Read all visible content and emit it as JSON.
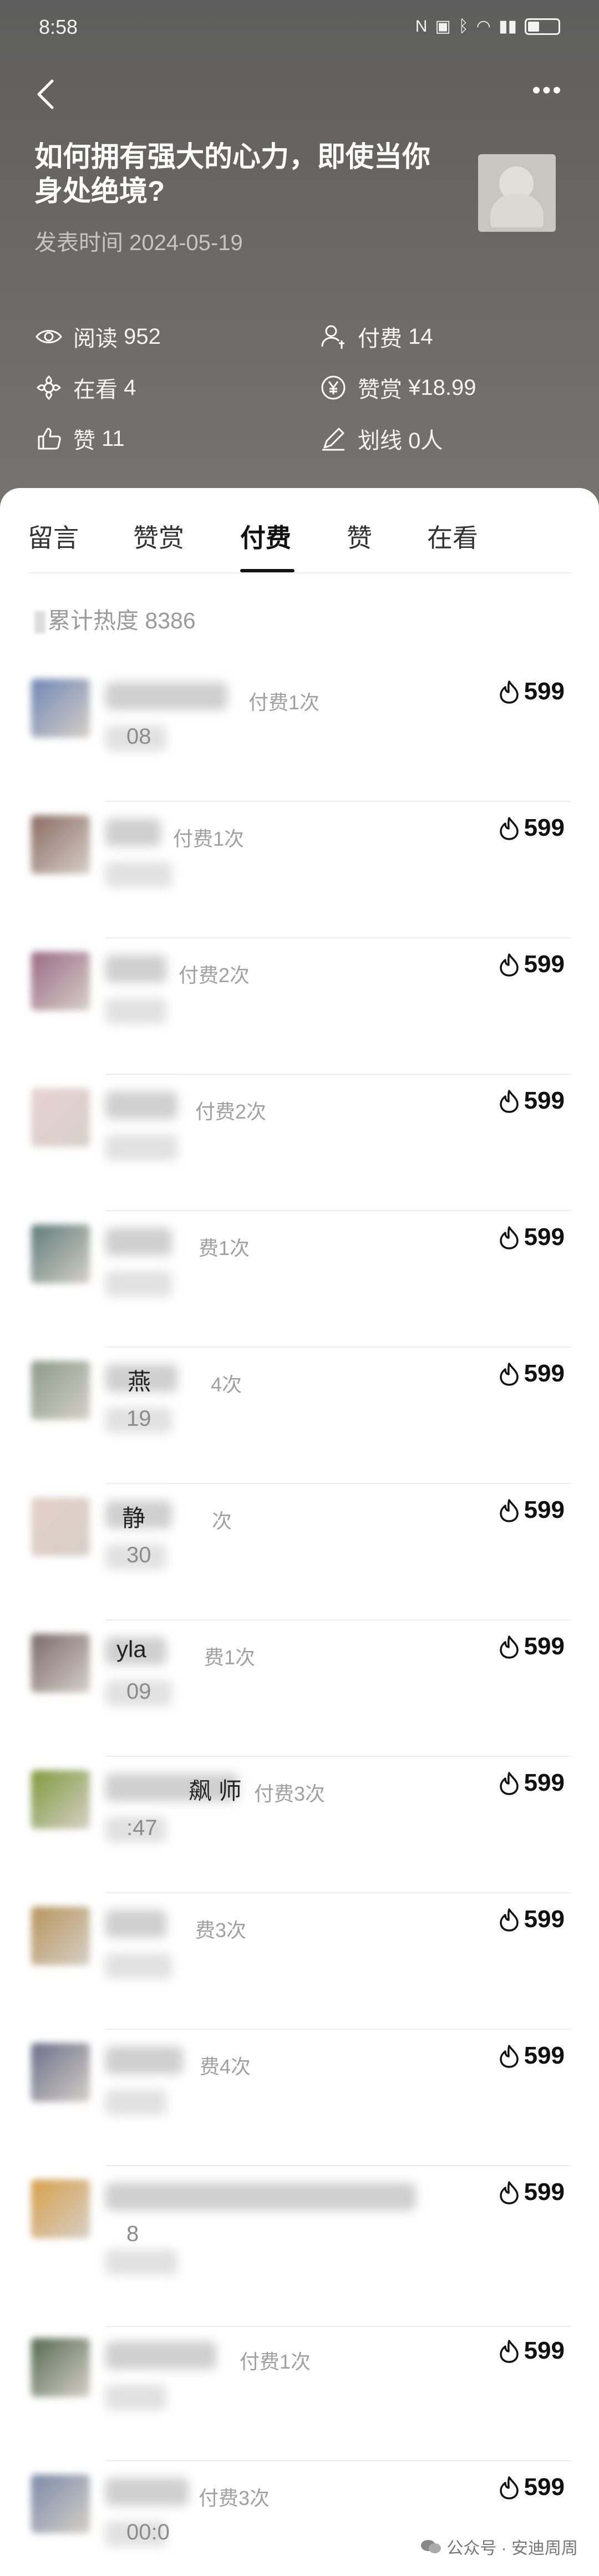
{
  "status": {
    "time": "8:58"
  },
  "article": {
    "title": "如何拥有强大的心力，即使当你身处绝境?",
    "publish_label": "发表时间",
    "publish_date": "2024-05-19"
  },
  "stats": [
    {
      "icon": "eye-icon",
      "label": "阅读",
      "value": "952"
    },
    {
      "icon": "user-pay-icon",
      "label": "付费",
      "value": "14"
    },
    {
      "icon": "flower-icon",
      "label": "在看",
      "value": "4"
    },
    {
      "icon": "yen-icon",
      "label": "赞赏",
      "value": "¥18.99"
    },
    {
      "icon": "thumb-up-icon",
      "label": "赞",
      "value": "11"
    },
    {
      "icon": "pen-icon",
      "label": "划线",
      "value": "0人"
    }
  ],
  "tabs": [
    {
      "label": "留言"
    },
    {
      "label": "赞赏"
    },
    {
      "label": "付费",
      "active": true
    },
    {
      "label": "赞"
    },
    {
      "label": "在看"
    }
  ],
  "heat": {
    "label": "累计热度",
    "value": "8386"
  },
  "rows": [
    {
      "name_visible": "",
      "pay": "付费1次",
      "time_visible": "08",
      "score": "599",
      "avatar_color": "#6f86b4"
    },
    {
      "name_visible": "",
      "pay": "付费1次",
      "time_visible": "",
      "score": "599",
      "avatar_color": "#8a6b62"
    },
    {
      "name_visible": "",
      "pay": "付费2次",
      "time_visible": "",
      "score": "599",
      "avatar_color": "#9a6a86"
    },
    {
      "name_visible": "",
      "pay": "付费2次",
      "time_visible": "",
      "score": "599",
      "avatar_color": "#e7d2d2"
    },
    {
      "name_visible": "",
      "pay": "费1次",
      "time_visible": "",
      "score": "599",
      "avatar_color": "#5f7c7a"
    },
    {
      "name_visible": "燕",
      "pay": "4次",
      "time_visible": "19",
      "score": "599",
      "avatar_color": "#8a9a8a"
    },
    {
      "name_visible": "静",
      "pay": "次",
      "time_visible": "30",
      "score": "599",
      "avatar_color": "#e4d0c8"
    },
    {
      "name_visible": "yla",
      "pay": "费1次",
      "time_visible": "09",
      "score": "599",
      "avatar_color": "#7a6a6a"
    },
    {
      "name_visible": "飙 师",
      "pay": "付费3次",
      "time_visible": ":47",
      "score": "599",
      "avatar_color": "#7f9a3c"
    },
    {
      "name_visible": "",
      "pay": "费3次",
      "time_visible": "",
      "score": "599",
      "avatar_color": "#b8955c"
    },
    {
      "name_visible": "",
      "pay": "费4次",
      "time_visible": "",
      "score": "599",
      "avatar_color": "#6a6e8a"
    },
    {
      "name_visible": "",
      "pay": "",
      "time_visible": "8",
      "score": "599",
      "avatar_color": "#d8a04a"
    },
    {
      "name_visible": "",
      "pay": "付费1次",
      "time_visible": "",
      "score": "599",
      "avatar_color": "#546a50"
    },
    {
      "name_visible": "",
      "pay": "付费3次",
      "time_visible": "00:0",
      "score": "599",
      "avatar_color": "#7a8aa8"
    }
  ],
  "watermark": {
    "text": "公众号 · 安迪周周"
  },
  "colors": {
    "header_bg": "#666462",
    "tab_active": "#111111",
    "muted": "#9a9a9a"
  }
}
